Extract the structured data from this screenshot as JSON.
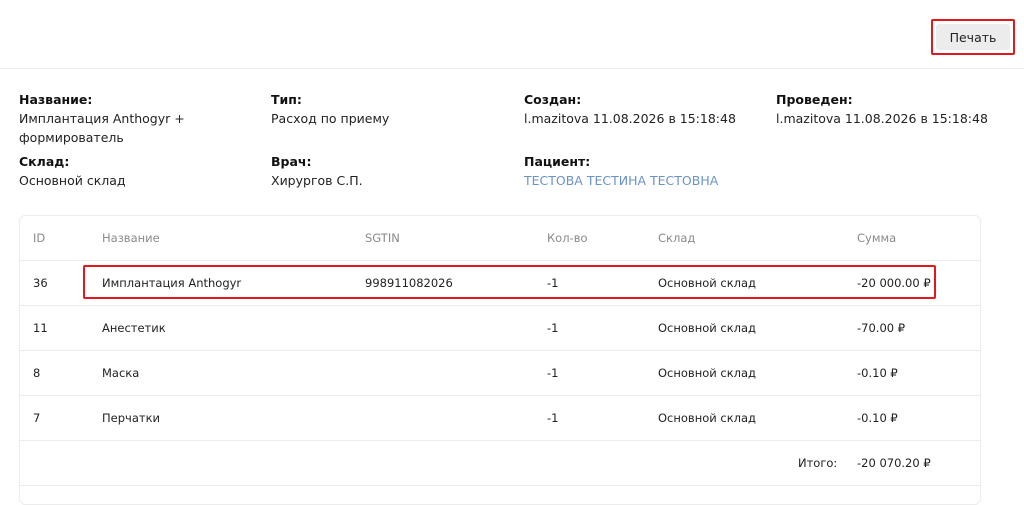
{
  "toolbar": {
    "print_label": "Печать"
  },
  "info": {
    "name_label": "Название:",
    "name_line1": "Имплантация Anthogyr +",
    "name_line2": "формирователь",
    "type_label": "Тип:",
    "type_value": "Расход по приему",
    "created_label": "Создан:",
    "created_value": "l.mazitova 11.08.2026 в 15:18:48",
    "posted_label": "Проведен:",
    "posted_value": "l.mazitova 11.08.2026 в 15:18:48",
    "warehouse_label": "Склад:",
    "warehouse_value": "Основной склад",
    "doctor_label": "Врач:",
    "doctor_value": "Хирургов С.П.",
    "patient_label": "Пациент:",
    "patient_value": "ТЕСТОВА ТЕСТИНА ТЕСТОВНА"
  },
  "table": {
    "headers": [
      "ID",
      "Название",
      "SGTIN",
      "Кол-во",
      "Склад",
      "Сумма"
    ],
    "rows": [
      {
        "id": "36",
        "name": "Имплантация Anthogyr",
        "sgtin": "998911082026",
        "qty": "-1",
        "warehouse": "Основной склад",
        "sum": "-20 000.00 ₽"
      },
      {
        "id": "11",
        "name": "Анестетик",
        "sgtin": "",
        "qty": "-1",
        "warehouse": "Основной склад",
        "sum": "-70.00 ₽"
      },
      {
        "id": "8",
        "name": "Маска",
        "sgtin": "",
        "qty": "-1",
        "warehouse": "Основной склад",
        "sum": "-0.10 ₽"
      },
      {
        "id": "7",
        "name": "Перчатки",
        "sgtin": "",
        "qty": "-1",
        "warehouse": "Основной склад",
        "sum": "-0.10 ₽"
      }
    ],
    "total_label": "Итого:",
    "total_value": "-20 070.20 ₽"
  },
  "colors": {
    "highlight": "#e0191f",
    "link": "#6a93c8",
    "border": "#ececec"
  }
}
